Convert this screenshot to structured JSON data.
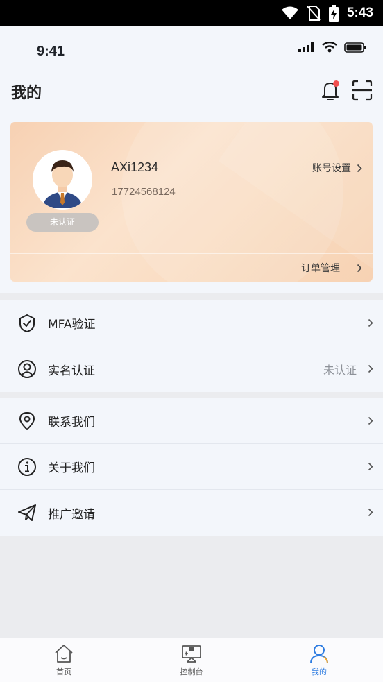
{
  "system_bar": {
    "time": "5:43"
  },
  "ios_status": {
    "time": "9:41"
  },
  "header": {
    "title": "我的"
  },
  "profile": {
    "username": "AXi1234",
    "phone": "17724568124",
    "verify_status": "未认证",
    "account_settings": "账号设置",
    "order_management": "订单管理"
  },
  "menu_group_1": [
    {
      "label": "MFA验证",
      "icon": "shield-check-icon",
      "value": ""
    },
    {
      "label": "实名认证",
      "icon": "user-circle-icon",
      "value": "未认证"
    }
  ],
  "menu_group_2": [
    {
      "label": "联系我们",
      "icon": "location-pin-icon",
      "value": ""
    },
    {
      "label": "关于我们",
      "icon": "info-icon",
      "value": ""
    },
    {
      "label": "推广邀请",
      "icon": "paper-plane-icon",
      "value": ""
    }
  ],
  "tabbar": [
    {
      "label": "首页",
      "icon": "home-icon",
      "active": false
    },
    {
      "label": "控制台",
      "icon": "console-icon",
      "active": false
    },
    {
      "label": "我的",
      "icon": "profile-icon",
      "active": true
    }
  ],
  "colors": {
    "accent": "#2f7de1",
    "badge": "#f24e4e",
    "card_gradient_start": "#f7d1b3",
    "card_gradient_end": "#f7d2b3"
  }
}
